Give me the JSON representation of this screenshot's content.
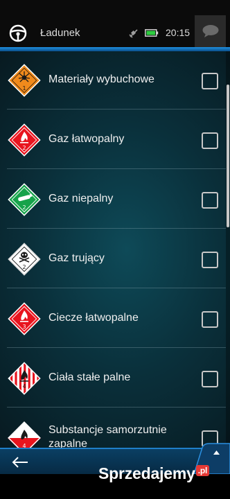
{
  "header": {
    "title": "Ładunek",
    "time": "20:15",
    "accent_color": "#1f8fe0"
  },
  "items": [
    {
      "label": "Materiały wybuchowe",
      "sign_number": "1",
      "sign_icon": "explosive-icon",
      "checked": false
    },
    {
      "label": "Gaz łatwopalny",
      "sign_number": "2",
      "sign_icon": "flame-icon",
      "checked": false
    },
    {
      "label": "Gaz niepalny",
      "sign_number": "2",
      "sign_icon": "gas-cylinder-icon",
      "checked": false
    },
    {
      "label": "Gaz trujący",
      "sign_number": "2",
      "sign_icon": "skull-icon",
      "checked": false
    },
    {
      "label": "Ciecze łatwopalne",
      "sign_number": "3",
      "sign_icon": "flame-icon",
      "checked": false
    },
    {
      "label": "Ciała stałe palne",
      "sign_number": "4",
      "sign_icon": "flame-icon",
      "checked": false
    },
    {
      "label": "Substancje samorzutnie zapalne",
      "sign_number": "4",
      "sign_icon": "flame-icon",
      "checked": false
    }
  ],
  "watermark": {
    "text": "Sprzedajemy",
    "tld": ".pl"
  }
}
